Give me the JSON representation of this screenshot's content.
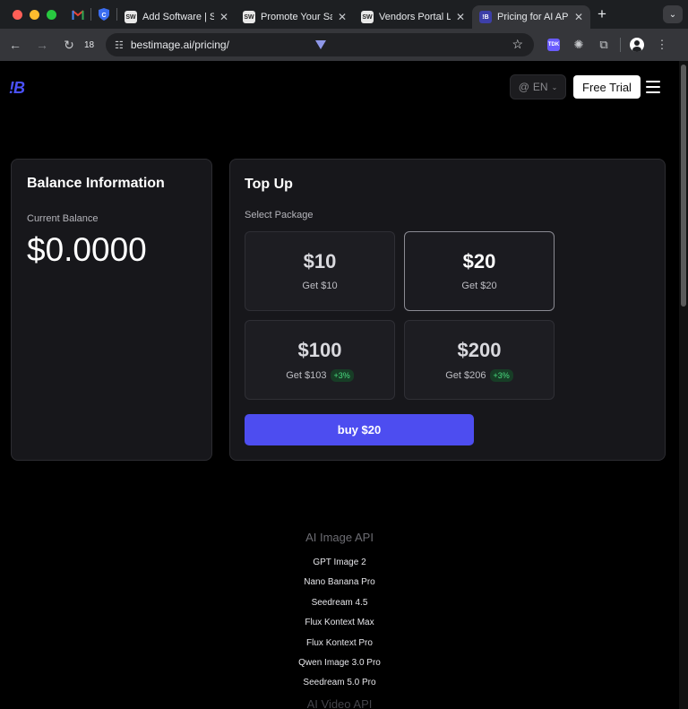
{
  "browser": {
    "tabs": [
      {
        "title": "Add Software | S",
        "favicon": "SW",
        "active": false
      },
      {
        "title": "Promote Your Sa",
        "favicon": "SW",
        "active": false
      },
      {
        "title": "Vendors Portal L",
        "favicon": "SW",
        "active": false
      },
      {
        "title": "Pricing for AI AP",
        "favicon": "!B",
        "active": true
      }
    ],
    "tab_count": "18",
    "url": "bestimage.ai/pricing/",
    "extension_label": "TDK"
  },
  "site": {
    "logo": "!B",
    "language": "EN",
    "free_trial_label": "Free Trial"
  },
  "balance": {
    "title": "Balance Information",
    "label": "Current Balance",
    "amount": "$0.0000"
  },
  "topup": {
    "title": "Top Up",
    "select_label": "Select Package",
    "packages": [
      {
        "price": "$10",
        "get": "Get $10",
        "bonus": null,
        "selected": false
      },
      {
        "price": "$20",
        "get": "Get $20",
        "bonus": null,
        "selected": true
      },
      {
        "price": "$100",
        "get": "Get $103",
        "bonus": "+3%",
        "selected": false
      },
      {
        "price": "$200",
        "get": "Get $206",
        "bonus": "+3%",
        "selected": false
      }
    ],
    "buy_label": "buy $20"
  },
  "footer": {
    "heading": "AI Image API",
    "links": [
      "GPT Image 2",
      "Nano Banana Pro",
      "Seedream 4.5",
      "Flux Kontext Max",
      "Flux Kontext Pro",
      "Qwen Image 3.0 Pro",
      "Seedream 5.0 Pro"
    ],
    "next_heading": "AI Video API"
  },
  "colors": {
    "accent": "#4d4df0",
    "logo": "#4b52ff",
    "bonus_text": "#4ade80",
    "card_bg": "#17171b"
  }
}
